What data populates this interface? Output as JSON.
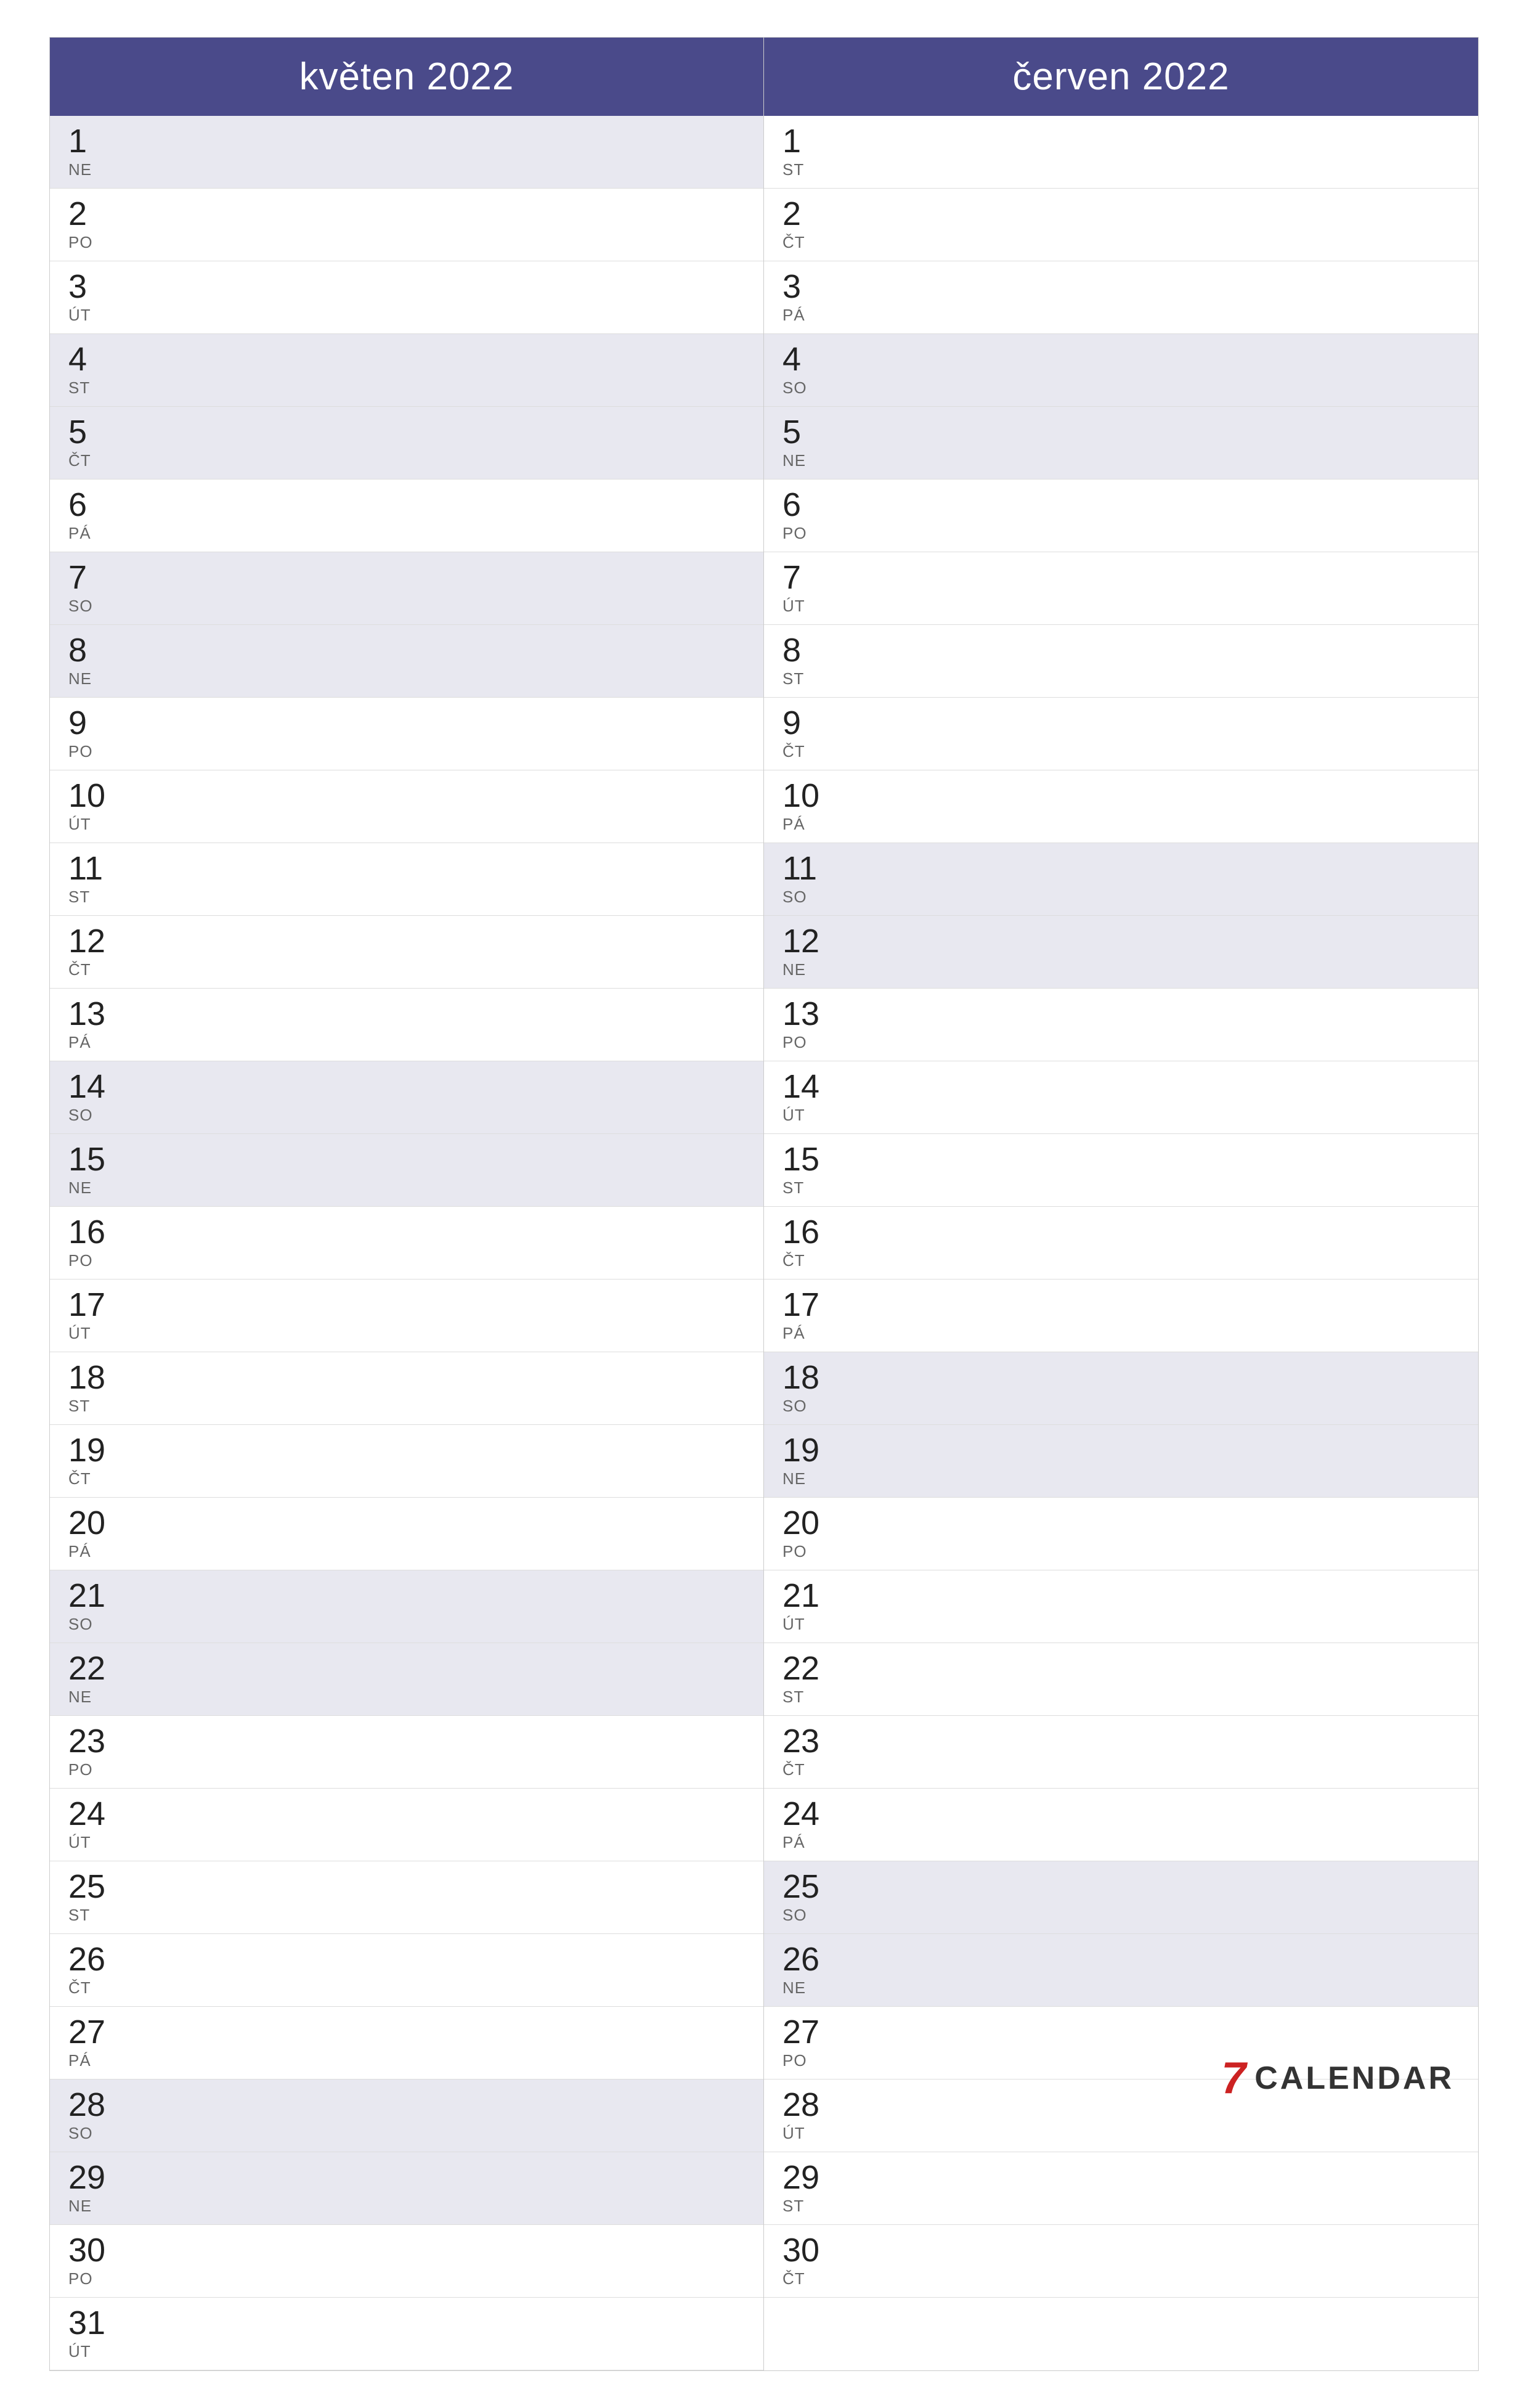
{
  "months": [
    {
      "name": "květen 2022",
      "days": [
        {
          "number": "1",
          "name": "NE",
          "weekend": true
        },
        {
          "number": "2",
          "name": "PO",
          "weekend": false
        },
        {
          "number": "3",
          "name": "ÚT",
          "weekend": false
        },
        {
          "number": "4",
          "name": "ST",
          "weekend": true
        },
        {
          "number": "5",
          "name": "ČT",
          "weekend": true
        },
        {
          "number": "6",
          "name": "PÁ",
          "weekend": false
        },
        {
          "number": "7",
          "name": "SO",
          "weekend": true
        },
        {
          "number": "8",
          "name": "NE",
          "weekend": true
        },
        {
          "number": "9",
          "name": "PO",
          "weekend": false
        },
        {
          "number": "10",
          "name": "ÚT",
          "weekend": false
        },
        {
          "number": "11",
          "name": "ST",
          "weekend": false
        },
        {
          "number": "12",
          "name": "ČT",
          "weekend": false
        },
        {
          "number": "13",
          "name": "PÁ",
          "weekend": false
        },
        {
          "number": "14",
          "name": "SO",
          "weekend": true
        },
        {
          "number": "15",
          "name": "NE",
          "weekend": true
        },
        {
          "number": "16",
          "name": "PO",
          "weekend": false
        },
        {
          "number": "17",
          "name": "ÚT",
          "weekend": false
        },
        {
          "number": "18",
          "name": "ST",
          "weekend": false
        },
        {
          "number": "19",
          "name": "ČT",
          "weekend": false
        },
        {
          "number": "20",
          "name": "PÁ",
          "weekend": false
        },
        {
          "number": "21",
          "name": "SO",
          "weekend": true
        },
        {
          "number": "22",
          "name": "NE",
          "weekend": true
        },
        {
          "number": "23",
          "name": "PO",
          "weekend": false
        },
        {
          "number": "24",
          "name": "ÚT",
          "weekend": false
        },
        {
          "number": "25",
          "name": "ST",
          "weekend": false
        },
        {
          "number": "26",
          "name": "ČT",
          "weekend": false
        },
        {
          "number": "27",
          "name": "PÁ",
          "weekend": false
        },
        {
          "number": "28",
          "name": "SO",
          "weekend": true
        },
        {
          "number": "29",
          "name": "NE",
          "weekend": true
        },
        {
          "number": "30",
          "name": "PO",
          "weekend": false
        },
        {
          "number": "31",
          "name": "ÚT",
          "weekend": false
        }
      ]
    },
    {
      "name": "červen 2022",
      "days": [
        {
          "number": "1",
          "name": "ST",
          "weekend": false
        },
        {
          "number": "2",
          "name": "ČT",
          "weekend": false
        },
        {
          "number": "3",
          "name": "PÁ",
          "weekend": false
        },
        {
          "number": "4",
          "name": "SO",
          "weekend": true
        },
        {
          "number": "5",
          "name": "NE",
          "weekend": true
        },
        {
          "number": "6",
          "name": "PO",
          "weekend": false
        },
        {
          "number": "7",
          "name": "ÚT",
          "weekend": false
        },
        {
          "number": "8",
          "name": "ST",
          "weekend": false
        },
        {
          "number": "9",
          "name": "ČT",
          "weekend": false
        },
        {
          "number": "10",
          "name": "PÁ",
          "weekend": false
        },
        {
          "number": "11",
          "name": "SO",
          "weekend": true
        },
        {
          "number": "12",
          "name": "NE",
          "weekend": true
        },
        {
          "number": "13",
          "name": "PO",
          "weekend": false
        },
        {
          "number": "14",
          "name": "ÚT",
          "weekend": false
        },
        {
          "number": "15",
          "name": "ST",
          "weekend": false
        },
        {
          "number": "16",
          "name": "ČT",
          "weekend": false
        },
        {
          "number": "17",
          "name": "PÁ",
          "weekend": false
        },
        {
          "number": "18",
          "name": "SO",
          "weekend": true
        },
        {
          "number": "19",
          "name": "NE",
          "weekend": true
        },
        {
          "number": "20",
          "name": "PO",
          "weekend": false
        },
        {
          "number": "21",
          "name": "ÚT",
          "weekend": false
        },
        {
          "number": "22",
          "name": "ST",
          "weekend": false
        },
        {
          "number": "23",
          "name": "ČT",
          "weekend": false
        },
        {
          "number": "24",
          "name": "PÁ",
          "weekend": false
        },
        {
          "number": "25",
          "name": "SO",
          "weekend": true
        },
        {
          "number": "26",
          "name": "NE",
          "weekend": true
        },
        {
          "number": "27",
          "name": "PO",
          "weekend": false
        },
        {
          "number": "28",
          "name": "ÚT",
          "weekend": false
        },
        {
          "number": "29",
          "name": "ST",
          "weekend": false
        },
        {
          "number": "30",
          "name": "ČT",
          "weekend": false
        }
      ]
    }
  ],
  "logo": {
    "icon": "7",
    "text": "CALENDAR"
  }
}
